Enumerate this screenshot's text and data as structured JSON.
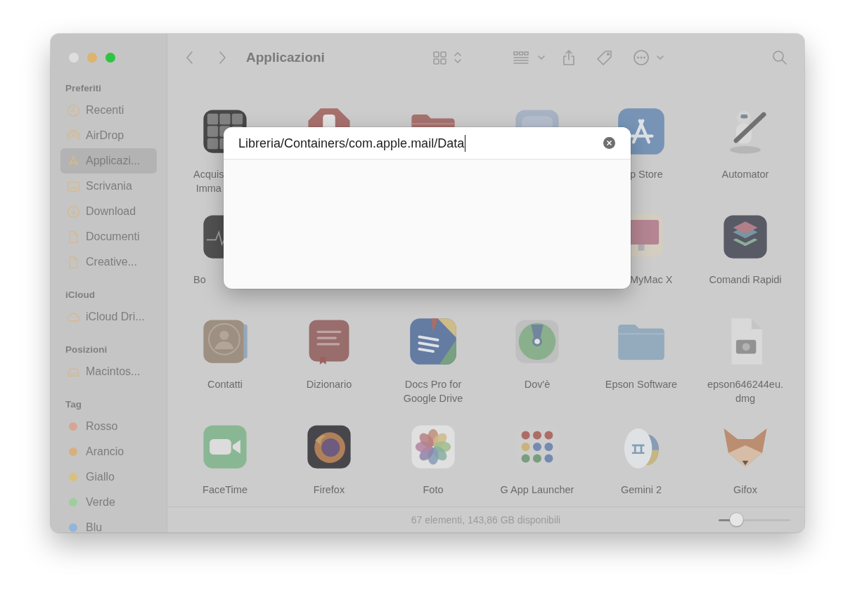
{
  "window": {
    "title": "Applicazioni"
  },
  "sidebar": {
    "sections": [
      {
        "title": "Preferiti",
        "items": [
          {
            "kind": "place",
            "label": "Recenti",
            "selected": false
          },
          {
            "kind": "place",
            "label": "AirDrop",
            "selected": false
          },
          {
            "kind": "place",
            "label": "Applicazi...",
            "selected": true
          },
          {
            "kind": "place",
            "label": "Scrivania",
            "selected": false
          },
          {
            "kind": "place",
            "label": "Download",
            "selected": false
          },
          {
            "kind": "place",
            "label": "Documenti",
            "selected": false
          },
          {
            "kind": "place",
            "label": "Creative...",
            "selected": false
          }
        ]
      },
      {
        "title": "iCloud",
        "items": [
          {
            "kind": "place",
            "label": "iCloud Dri...",
            "selected": false
          }
        ]
      },
      {
        "title": "Posizioni",
        "items": [
          {
            "kind": "place",
            "label": "Macintos...",
            "selected": false
          }
        ]
      },
      {
        "title": "Tag",
        "items": [
          {
            "kind": "tag",
            "label": "Rosso",
            "color": "#d9a593",
            "selected": false
          },
          {
            "kind": "tag",
            "label": "Arancio",
            "color": "#d8b07f",
            "selected": false
          },
          {
            "kind": "tag",
            "label": "Giallo",
            "color": "#d8c07f",
            "selected": false
          },
          {
            "kind": "tag",
            "label": "Verde",
            "color": "#9ccf9c",
            "selected": false
          },
          {
            "kind": "tag",
            "label": "Blu",
            "color": "#93b5d9",
            "selected": false
          }
        ]
      }
    ]
  },
  "grid": {
    "rows": [
      [
        {
          "kind": "cutend",
          "lines": [
            "Acquis",
            "Imma"
          ]
        },
        {
          "kind": "app"
        },
        {
          "kind": "app"
        },
        {
          "kind": "app"
        },
        {
          "kind": "cutstart",
          "lines": [
            "p Store"
          ]
        },
        {
          "kind": "app",
          "lines": [
            "Automator"
          ]
        }
      ],
      [
        {
          "kind": "cutend",
          "lines": [
            "Bo"
          ]
        },
        {
          "kind": "covered"
        },
        {
          "kind": "covered"
        },
        {
          "kind": "covered"
        },
        {
          "kind": "cutstart",
          "lines": [
            "MyMac X"
          ]
        },
        {
          "kind": "app",
          "lines": [
            "Comandi Rapidi"
          ]
        }
      ],
      [
        {
          "kind": "app",
          "lines": [
            "Contatti"
          ]
        },
        {
          "kind": "app",
          "lines": [
            "Dizionario"
          ]
        },
        {
          "kind": "app",
          "lines": [
            "Docs Pro for",
            "Google Drive"
          ]
        },
        {
          "kind": "app",
          "lines": [
            "Dov'è"
          ]
        },
        {
          "kind": "app",
          "lines": [
            "Epson Software"
          ]
        },
        {
          "kind": "app",
          "lines": [
            "epson646244eu.",
            "dmg"
          ]
        }
      ],
      [
        {
          "kind": "app",
          "lines": [
            "FaceTime"
          ]
        },
        {
          "kind": "app",
          "lines": [
            "Firefox"
          ]
        },
        {
          "kind": "app",
          "lines": [
            "Foto"
          ]
        },
        {
          "kind": "app",
          "lines": [
            "G App Launcher"
          ]
        },
        {
          "kind": "app",
          "lines": [
            "Gemini 2"
          ]
        },
        {
          "kind": "app",
          "lines": [
            "Gifox"
          ]
        }
      ]
    ]
  },
  "goto_sheet": {
    "path_field": {
      "value": "Libreria/Containers/com.apple.mail/Data"
    }
  },
  "status_bar": {
    "text": "67 elementi, 143,86 GB disponibili",
    "zoom_slider": {
      "level": 0.25
    }
  }
}
